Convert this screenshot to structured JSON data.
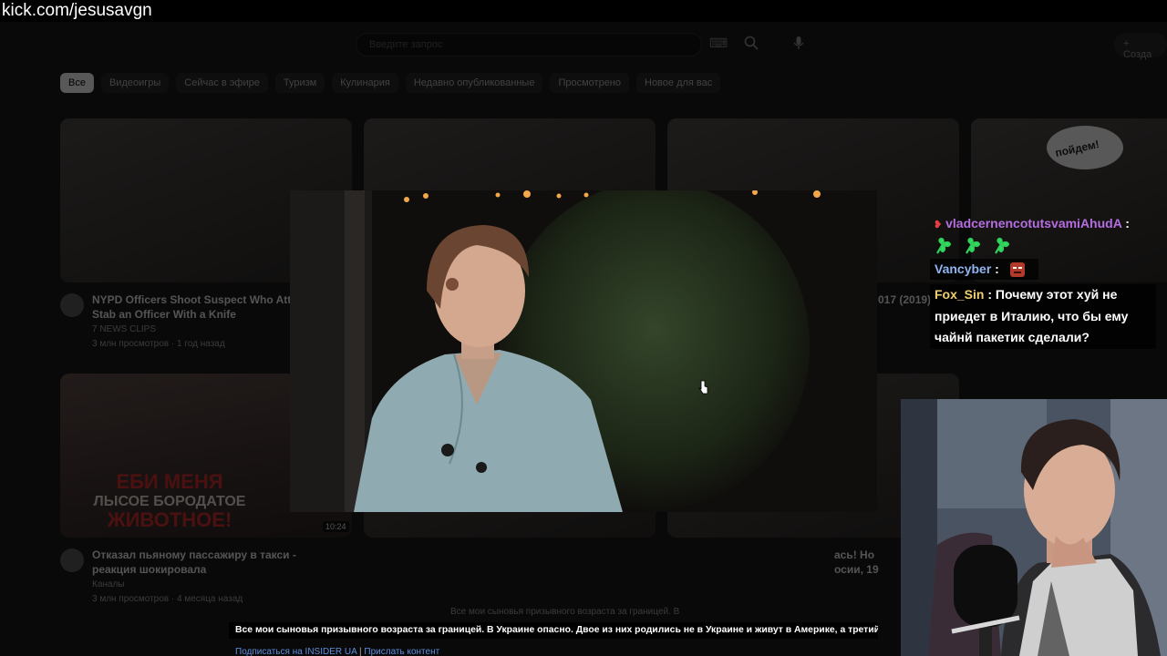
{
  "url_bar": {
    "text": "kick.com/jesusavgn"
  },
  "youtube": {
    "search_placeholder": "Введите запрос",
    "create_label": "+ Созда",
    "chips": [
      "Все",
      "Видеоигры",
      "Сейчас в эфире",
      "Туризм",
      "Кулинария",
      "Недавно опубликованные",
      "Просмотрено",
      "Новое для вас"
    ],
    "videos": [
      {
        "title_line1": "NYPD Officers Shoot Suspect Who Atter",
        "title_line2": "Stab an Officer With a Knife",
        "channel": "7 NEWS CLIPS",
        "meta": "3 млн просмотров · 1 год назад"
      },
      {
        "title_line1": "Отказал пьяному пассажиру в такси -",
        "title_line2": "реакция шокировала",
        "channel": "Каналы",
        "meta": "3 млн просмотров · 4 месяца назад"
      },
      {
        "title_line1": "017 (2019)",
        "title_line2": "",
        "channel": "",
        "meta": ""
      },
      {
        "title_line1": "ась! Но",
        "title_line2": "осии, 19",
        "channel": "",
        "meta": ""
      }
    ],
    "thumb_text_line1": "ЕБИ МЕНЯ",
    "thumb_text_line2": "ЛЫСОЕ БОРОДАТОЕ",
    "thumb_text_line3": "ЖИВОТНОЕ!",
    "bubble_text": "пойдем!",
    "duration": "10:24",
    "faded_caption": "Все мои сыновья призывного возраста за границей. В"
  },
  "chat": {
    "messages": [
      {
        "user": "vladcernencotutsvamiAhudA",
        "sep": " :",
        "text": ""
      },
      {
        "user": "Vancyber",
        "sep": " :",
        "text": ""
      },
      {
        "user": "Fox_Sin",
        "sep": " :",
        "text": "Почему этот хуй не"
      },
      {
        "text2": "приедет в Италию, что бы ему"
      },
      {
        "text3": "чайнй пакетик сделали?"
      }
    ]
  },
  "subtitle": {
    "text": "Все мои сыновья призывного возраста за границей. В Украине опасно. Двое из них родились не в Украине и живут в Америке, а третий - более",
    "link1": "Подписаться на INSIDER UA",
    "sep": "|",
    "link2": "Прислать контент"
  },
  "colors": {
    "chat_user_1": "#b46ee0",
    "chat_user_2": "#8fb4f0",
    "chat_user_3": "#f0d070",
    "link": "#5d8fe0"
  },
  "icons": [
    "keyboard-icon",
    "search-icon",
    "mic-icon",
    "cursor-icon",
    "clover-emote",
    "devil-emote"
  ]
}
